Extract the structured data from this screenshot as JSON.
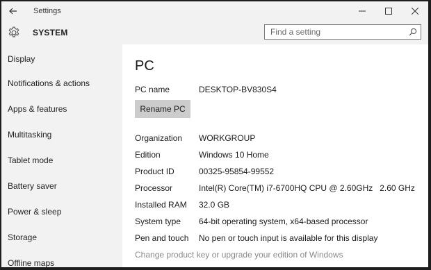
{
  "window": {
    "title": "Settings",
    "controls": {
      "minimize": "—",
      "maximize": "☐",
      "close": "✕"
    }
  },
  "header": {
    "title": "SYSTEM",
    "icon": "gear-icon",
    "search_placeholder": "Find a setting"
  },
  "sidebar": {
    "items": [
      {
        "label": "Display"
      },
      {
        "label": "Notifications & actions"
      },
      {
        "label": "Apps & features"
      },
      {
        "label": "Multitasking"
      },
      {
        "label": "Tablet mode"
      },
      {
        "label": "Battery saver"
      },
      {
        "label": "Power & sleep"
      },
      {
        "label": "Storage"
      },
      {
        "label": "Offline maps"
      }
    ]
  },
  "main": {
    "title": "PC",
    "pc_name": {
      "label": "PC name",
      "value": "DESKTOP-BV830S4"
    },
    "rename_button": "Rename PC",
    "details": [
      {
        "label": "Organization",
        "value": "WORKGROUP"
      },
      {
        "label": "Edition",
        "value": "Windows 10 Home"
      },
      {
        "label": "Product ID",
        "value": "00325-95854-99552"
      },
      {
        "label": "Processor",
        "value": "Intel(R) Core(TM) i7-6700HQ CPU @ 2.60GHz   2.60 GHz"
      },
      {
        "label": "Installed RAM",
        "value": "32.0 GB"
      },
      {
        "label": "System type",
        "value": "64-bit operating system, x64-based processor"
      },
      {
        "label": "Pen and touch",
        "value": "No pen or touch input is available for this display"
      }
    ],
    "link": "Change product key or upgrade your edition of Windows"
  },
  "colors": {
    "window_bg": "#f2f2f2",
    "content_bg": "#ffffff",
    "button_bg": "#cccccc",
    "link_text": "#8a8a8a"
  }
}
